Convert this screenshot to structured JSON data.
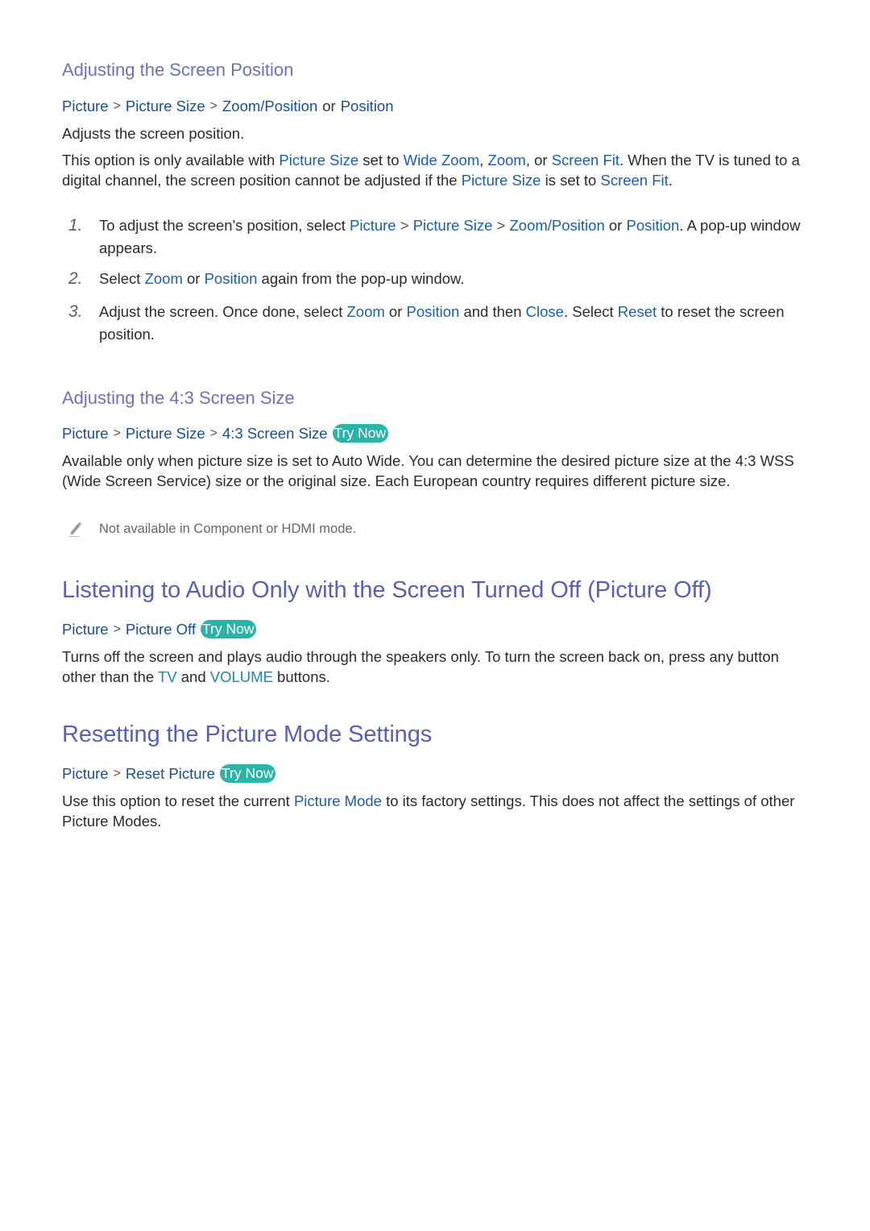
{
  "sections": {
    "screen_position": {
      "heading": "Adjusting the Screen Position",
      "path": [
        "Picture",
        "Picture Size",
        "Zoom/Position"
      ],
      "path_or": "or",
      "path_alt": "Position",
      "intro": "Adjusts the screen position.",
      "para": {
        "t1": "This option is only available with ",
        "h1": "Picture Size",
        "t2": " set to ",
        "h2": "Wide Zoom",
        "t3": ", ",
        "h3": "Zoom",
        "t4": ", or ",
        "h4": "Screen Fit",
        "t5": ". When the TV is tuned to a digital channel, the screen position cannot be adjusted if the ",
        "h5": "Picture Size",
        "t6": " is set to ",
        "h6": "Screen Fit",
        "t7": "."
      },
      "steps": [
        {
          "num": "1.",
          "t1": "To adjust the screen's position, select ",
          "h1": "Picture",
          "sep": ">",
          "h2": "Picture Size",
          "h3": "Zoom/Position",
          "t2": " or ",
          "h4": "Position",
          "t3": ". A pop-up window appears."
        },
        {
          "num": "2.",
          "t1": "Select ",
          "h1": "Zoom",
          "t2": " or ",
          "h2": "Position",
          "t3": " again from the pop-up window."
        },
        {
          "num": "3.",
          "t1": "Adjust the screen. Once done, select ",
          "h1": "Zoom",
          "t2": " or ",
          "h2": "Position",
          "t3": " and then ",
          "h3": "Close",
          "t4": ". Select ",
          "h4": "Reset",
          "t5": " to reset the screen position."
        }
      ]
    },
    "screen_43": {
      "heading": "Adjusting the 4:3 Screen Size",
      "path": [
        "Picture",
        "Picture Size",
        "4:3 Screen Size"
      ],
      "try_now": "Try Now",
      "para": "Available only when picture size is set to Auto Wide. You can determine the desired picture size at the 4:3 WSS (Wide Screen Service) size or the original size. Each European country requires different picture size.",
      "note_icon": "pencil-icon",
      "note": "Not available in Component or HDMI mode."
    },
    "picture_off": {
      "heading": "Listening to Audio Only with the Screen Turned Off (Picture Off)",
      "path": [
        "Picture",
        "Picture Off"
      ],
      "try_now": "Try Now",
      "t1": "Turns off the screen and plays audio through the speakers only. To turn the screen back on, press any button other than the ",
      "h1": "TV",
      "t2": " and ",
      "h2": "VOLUME",
      "t3": " buttons."
    },
    "reset": {
      "heading": "Resetting the Picture Mode Settings",
      "path": [
        "Picture",
        "Reset Picture"
      ],
      "try_now": "Try Now",
      "t1": "Use this option to reset the current ",
      "h1": "Picture Mode",
      "t2": " to its factory settings. This does not affect the settings of other Picture Modes."
    }
  },
  "colors": {
    "heading": "#5a5fb5",
    "menu_path": "#1a4f8f",
    "highlight": "#1a5fa8",
    "button_highlight": "#1a8aa0",
    "try_now_bg": "#2ab3a9"
  }
}
